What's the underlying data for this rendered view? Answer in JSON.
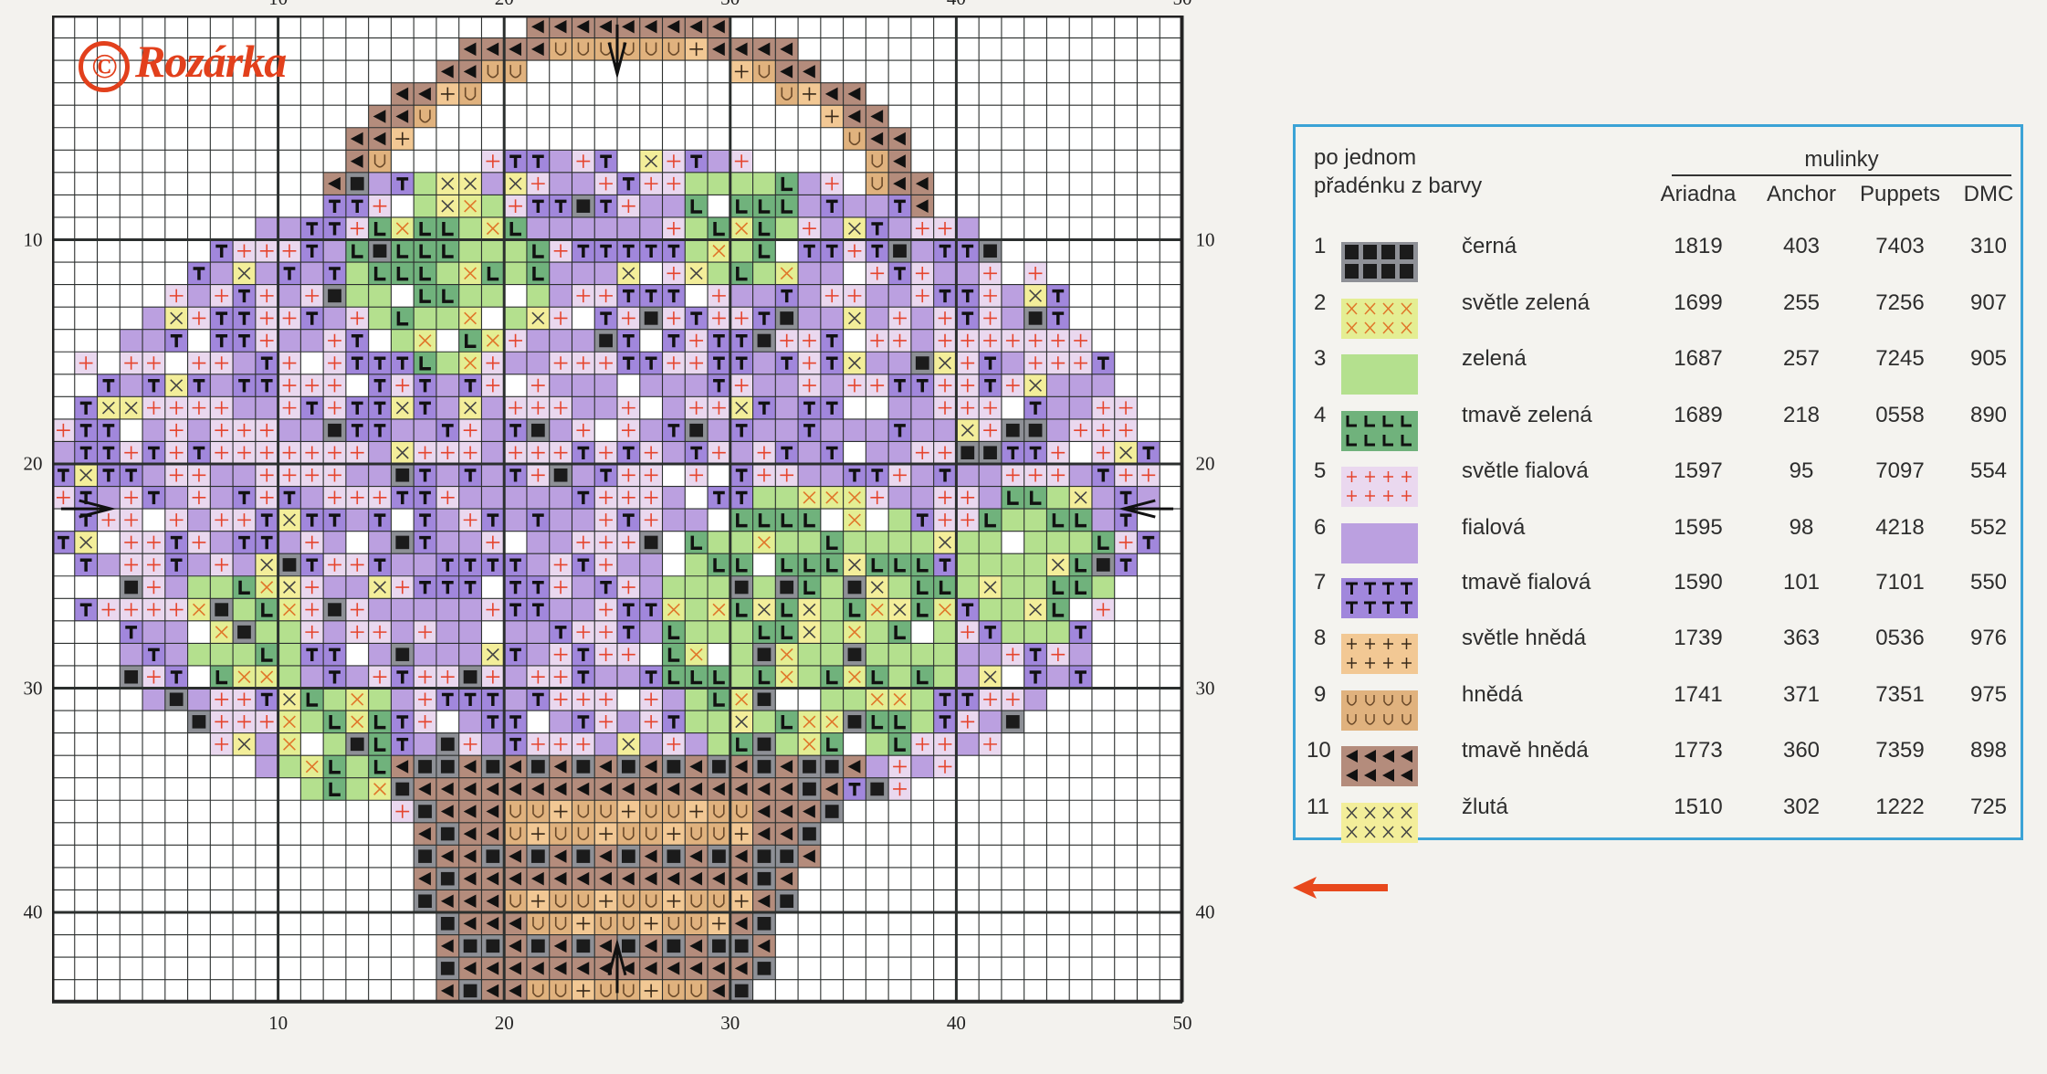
{
  "logo": {
    "symbol": "©",
    "text": "Rozárka",
    "color": "#e2401c"
  },
  "chart": {
    "columns": 50,
    "rows": 44,
    "x_axis_labels": [
      "10",
      "20",
      "30",
      "40",
      "50"
    ],
    "y_axis_labels": [
      "10",
      "20",
      "30",
      "40"
    ],
    "center_markers": [
      "top",
      "bottom",
      "left",
      "right"
    ]
  },
  "legend": {
    "header_left_line1": "po jednom",
    "header_left_line2": "přadénku z barvy",
    "group_header": "mulinky",
    "columns": [
      "Ariadna",
      "Anchor",
      "Puppets",
      "DMC"
    ],
    "border_color": "#3ba3d6",
    "rows": [
      {
        "num": "1",
        "name": "černá",
        "ariadna": "1819",
        "anchor": "403",
        "puppets": "7403",
        "dmc": "310",
        "color": "#8e9096",
        "symbol": "black-square"
      },
      {
        "num": "2",
        "name": "světle zelená",
        "ariadna": "1699",
        "anchor": "255",
        "puppets": "7256",
        "dmc": "907",
        "color": "#e4ee93",
        "symbol": "orange-x"
      },
      {
        "num": "3",
        "name": "zelená",
        "ariadna": "1687",
        "anchor": "257",
        "puppets": "7245",
        "dmc": "905",
        "color": "#b4e08e",
        "symbol": "none"
      },
      {
        "num": "4",
        "name": "tmavě zelená",
        "ariadna": "1689",
        "anchor": "218",
        "puppets": "0558",
        "dmc": "890",
        "color": "#70b27c",
        "symbol": "L"
      },
      {
        "num": "5",
        "name": "světle fialová",
        "ariadna": "1597",
        "anchor": "95",
        "puppets": "7097",
        "dmc": "554",
        "color": "#ead8ef",
        "symbol": "red-plus"
      },
      {
        "num": "6",
        "name": "fialová",
        "ariadna": "1595",
        "anchor": "98",
        "puppets": "4218",
        "dmc": "552",
        "color": "#bba0e0",
        "symbol": "none"
      },
      {
        "num": "7",
        "name": "tmavě fialová",
        "ariadna": "1590",
        "anchor": "101",
        "puppets": "7101",
        "dmc": "550",
        "color": "#a187dc",
        "symbol": "T"
      },
      {
        "num": "8",
        "name": "světle hnědá",
        "ariadna": "1739",
        "anchor": "363",
        "puppets": "0536",
        "dmc": "976",
        "color": "#f2c894",
        "symbol": "plus"
      },
      {
        "num": "9",
        "name": "hnědá",
        "ariadna": "1741",
        "anchor": "371",
        "puppets": "7351",
        "dmc": "975",
        "color": "#e0b27e",
        "symbol": "U"
      },
      {
        "num": "10",
        "name": "tmavě hnědá",
        "ariadna": "1773",
        "anchor": "360",
        "puppets": "7359",
        "dmc": "898",
        "color": "#b48c7c",
        "symbol": "triangle-left"
      },
      {
        "num": "11",
        "name": "žlutá",
        "ariadna": "1510",
        "anchor": "302",
        "puppets": "1222",
        "dmc": "725",
        "color": "#f3ee9a",
        "symbol": "x"
      }
    ]
  },
  "page_arrow_color": "#e8481c"
}
